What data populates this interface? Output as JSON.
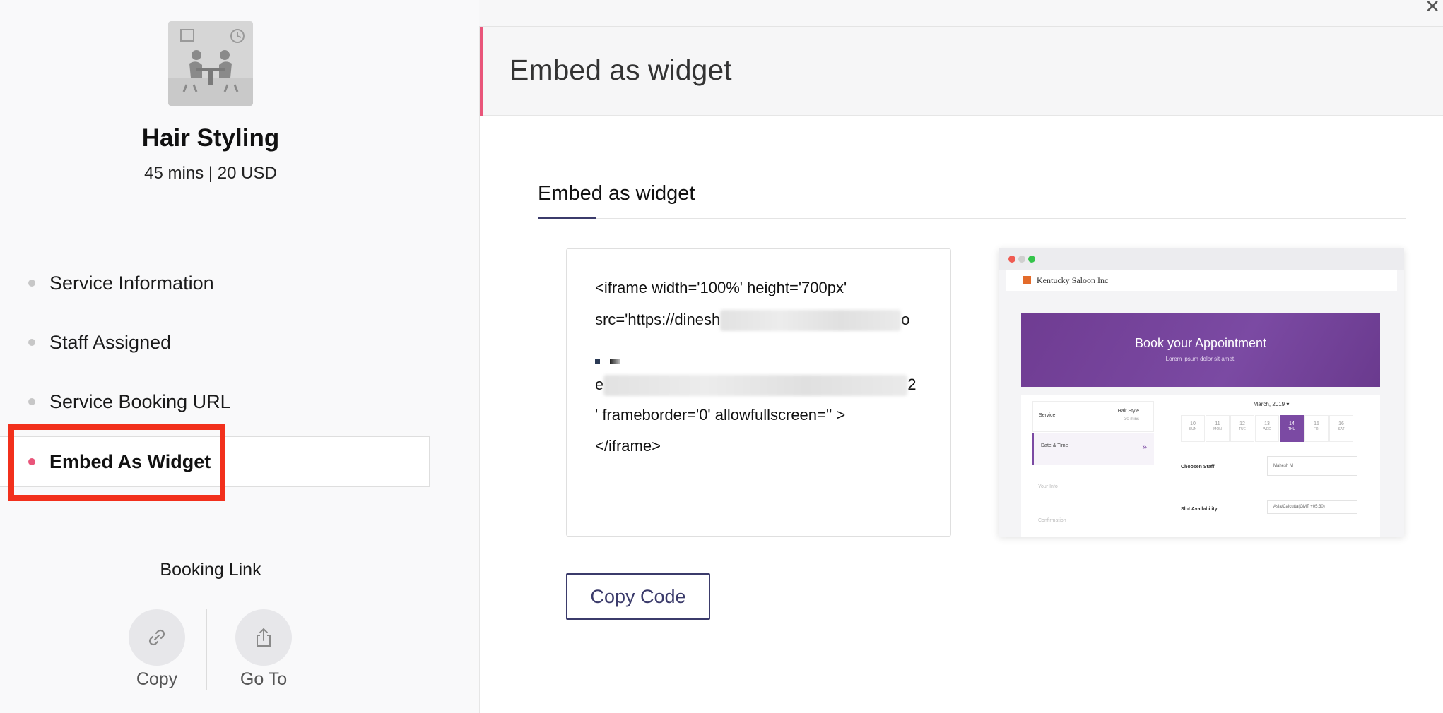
{
  "service": {
    "name": "Hair Styling",
    "meta": "45 mins | 20 USD"
  },
  "nav": {
    "items": [
      {
        "label": "Service Information"
      },
      {
        "label": "Staff Assigned"
      },
      {
        "label": "Service Booking URL"
      },
      {
        "label": "Embed As Widget"
      }
    ]
  },
  "booking_link": {
    "title": "Booking Link",
    "copy_label": "Copy",
    "goto_label": "Go To"
  },
  "panel": {
    "header_title": "Embed as widget",
    "section_title": "Embed as widget"
  },
  "code": {
    "line1": "<iframe width='100%' height='700px'",
    "line2_prefix": "src='https://dinesh",
    "line2_suffix": "o",
    "line4_prefix": "e",
    "line4_suffix": "2",
    "line5": "' frameborder='0' allowfullscreen='' >",
    "line6": "</iframe>"
  },
  "copy_button_label": "Copy Code",
  "preview": {
    "company": "Kentucky Saloon Inc",
    "banner_title": "Book your Appointment",
    "banner_sub": "Lorem ipsum dolor sit amet.",
    "service_label": "Service",
    "service_value": "Hair Style",
    "service_duration": "30 mins",
    "datetime_label": "Date & Time",
    "yourinfo_label": "Your Info",
    "confirmation_label": "Confirmation",
    "month": "March, 2019 ▾",
    "days": [
      {
        "num": "10",
        "dow": "SUN"
      },
      {
        "num": "11",
        "dow": "MON"
      },
      {
        "num": "12",
        "dow": "TUE"
      },
      {
        "num": "13",
        "dow": "WED"
      },
      {
        "num": "14",
        "dow": "THU"
      },
      {
        "num": "15",
        "dow": "FRI"
      },
      {
        "num": "16",
        "dow": "SAT"
      }
    ],
    "staff_label": "Choosen Staff",
    "staff_value": "Mahesh M",
    "slot_label": "Slot Availability",
    "slot_value": "Asia/Calcutta(GMT +05:30)"
  },
  "colors": {
    "accent_pink": "#e9557a",
    "brand_indigo": "#3b3b6b",
    "highlight_red": "#f2301c",
    "preview_purple": "#7b4aa3"
  }
}
